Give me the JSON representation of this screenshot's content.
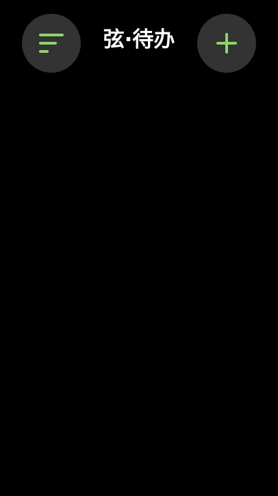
{
  "app": {
    "title": "弦·待办"
  },
  "header": {
    "left_button_icon": "filter-sort-icon",
    "right_button_icon": "plus-icon"
  },
  "colors": {
    "background": "#000000",
    "button_background": "#333333",
    "accent": "#8fd46a",
    "title_text": "#ffffff"
  },
  "todo_list": {
    "items": []
  }
}
